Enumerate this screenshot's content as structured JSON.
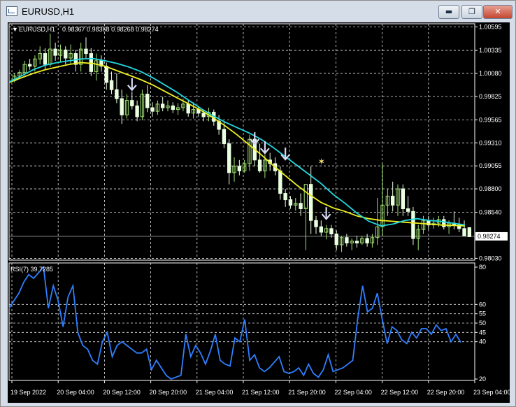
{
  "window": {
    "title": "EURUSD,H1",
    "minimize_label": "▬",
    "maximize_label": "❐",
    "close_label": "✕"
  },
  "chart_header": {
    "symbol": "EURUSD,H1",
    "ohlc": "0.98367 0.98368 0.98268 0.98274"
  },
  "price_axis": {
    "labels": [
      "1.00595",
      "1.00335",
      "1.00080",
      "0.99825",
      "0.99565",
      "0.99310",
      "0.99055",
      "0.98800",
      "0.98540",
      "0.98274",
      "0.98030"
    ],
    "current_price": "0.98274"
  },
  "rsi_panel": {
    "label": "RSI(7) 39.7285",
    "levels": [
      "80",
      "60",
      "55",
      "50",
      "45",
      "40",
      "20"
    ]
  },
  "time_axis": {
    "labels": [
      "19 Sep 2022",
      "20 Sep 04:00",
      "20 Sep 12:00",
      "20 Sep 20:00",
      "21 Sep 04:00",
      "21 Sep 12:00",
      "21 Sep 20:00",
      "22 Sep 04:00",
      "22 Sep 12:00",
      "22 Sep 20:00",
      "23 Sep 04:00"
    ]
  },
  "colors": {
    "background": "#000000",
    "grid": "#ffffff",
    "bull": "#a0e070",
    "bear": "#e8ffe0",
    "ma_fast": "#22d8e0",
    "ma_slow": "#f0f020",
    "rsi": "#2f7fff",
    "signal": "#d8d8f0",
    "star": "#f0e070"
  },
  "chart_data": {
    "type": "candlestick",
    "ylim": [
      0.9801,
      1.0063
    ],
    "rsi_ylim": [
      20,
      80
    ],
    "candles": [
      [
        1.0,
        1.0008,
        0.9998,
        1.0005
      ],
      [
        1.0005,
        1.0012,
        1.0002,
        1.0009
      ],
      [
        1.0009,
        1.0022,
        1.0006,
        1.0018
      ],
      [
        1.0018,
        1.0024,
        1.0012,
        1.0016
      ],
      [
        1.0016,
        1.0028,
        1.001,
        1.0024
      ],
      [
        1.0024,
        1.0038,
        1.0018,
        1.003
      ],
      [
        1.003,
        1.0036,
        1.0012,
        1.0018
      ],
      [
        1.0018,
        1.0052,
        1.0015,
        1.0035
      ],
      [
        1.0035,
        1.0042,
        1.0022,
        1.0028
      ],
      [
        1.0028,
        1.004,
        1.002,
        1.0034
      ],
      [
        1.0034,
        1.0038,
        1.0018,
        1.0025
      ],
      [
        1.0025,
        1.004,
        1.0018,
        1.003
      ],
      [
        1.003,
        1.0034,
        1.001,
        1.0018
      ],
      [
        1.0018,
        1.0042,
        1.001,
        1.0035
      ],
      [
        1.0035,
        1.0048,
        1.0025,
        1.003
      ],
      [
        1.003,
        1.0036,
        1.0005,
        1.001
      ],
      [
        1.001,
        1.003,
        1.0,
        1.0022
      ],
      [
        1.0022,
        1.0028,
        1.001,
        1.0016
      ],
      [
        1.0016,
        1.002,
        0.999,
        0.9998
      ],
      [
        1.0,
        1.001,
        0.9985,
        0.999
      ],
      [
        0.999,
        1.0008,
        0.9975,
        0.998
      ],
      [
        0.998,
        0.999,
        0.9952,
        0.9962
      ],
      [
        0.9962,
        0.9985,
        0.9958,
        0.9978
      ],
      [
        0.9978,
        0.9988,
        0.9968,
        0.9972
      ],
      [
        0.9972,
        0.9978,
        0.9955,
        0.996
      ],
      [
        0.996,
        0.999,
        0.9956,
        0.9985
      ],
      [
        0.9985,
        0.9995,
        0.9965,
        0.997
      ],
      [
        0.997,
        0.9976,
        0.996,
        0.9966
      ],
      [
        0.9966,
        0.9978,
        0.9962,
        0.9974
      ],
      [
        0.9974,
        0.9982,
        0.9966,
        0.997
      ],
      [
        0.997,
        0.9978,
        0.9966,
        0.9972
      ],
      [
        0.9972,
        0.9976,
        0.9964,
        0.9968
      ],
      [
        0.9968,
        0.9975,
        0.9962,
        0.997
      ],
      [
        0.997,
        0.998,
        0.9966,
        0.9974
      ],
      [
        0.9974,
        0.9978,
        0.996,
        0.9964
      ],
      [
        0.9964,
        0.9976,
        0.9958,
        0.9968
      ],
      [
        0.9968,
        0.9972,
        0.996,
        0.9964
      ],
      [
        0.9964,
        0.9968,
        0.9955,
        0.996
      ],
      [
        0.996,
        0.997,
        0.9955,
        0.9965
      ],
      [
        0.9965,
        0.9968,
        0.995,
        0.9955
      ],
      [
        0.9955,
        0.9962,
        0.994,
        0.9946
      ],
      [
        0.9946,
        0.9955,
        0.9925,
        0.993
      ],
      [
        0.993,
        0.9935,
        0.9885,
        0.9898
      ],
      [
        0.9898,
        0.9915,
        0.9888,
        0.9905
      ],
      [
        0.9905,
        0.9912,
        0.9895,
        0.99
      ],
      [
        0.99,
        0.9912,
        0.9898,
        0.9908
      ],
      [
        0.9908,
        0.994,
        0.99,
        0.9935
      ],
      [
        0.9935,
        0.994,
        0.9905,
        0.9912
      ],
      [
        0.9912,
        0.993,
        0.9898,
        0.99
      ],
      [
        0.99,
        0.9918,
        0.9892,
        0.9912
      ],
      [
        0.9912,
        0.992,
        0.99,
        0.9908
      ],
      [
        0.9908,
        0.9915,
        0.9895,
        0.99
      ],
      [
        0.99,
        0.9905,
        0.9868,
        0.9875
      ],
      [
        0.9875,
        0.988,
        0.986,
        0.9868
      ],
      [
        0.9868,
        0.9872,
        0.9858,
        0.9862
      ],
      [
        0.9862,
        0.987,
        0.9856,
        0.9864
      ],
      [
        0.9864,
        0.9875,
        0.985,
        0.9858
      ],
      [
        0.9858,
        0.986,
        0.9812,
        0.9885
      ],
      [
        0.9885,
        0.9905,
        0.983,
        0.9845
      ],
      [
        0.9845,
        0.985,
        0.983,
        0.9838
      ],
      [
        0.9838,
        0.9845,
        0.9828,
        0.9832
      ],
      [
        0.9832,
        0.984,
        0.9824,
        0.9836
      ],
      [
        0.9836,
        0.984,
        0.9826,
        0.983
      ],
      [
        0.983,
        0.9834,
        0.9812,
        0.9818
      ],
      [
        0.9818,
        0.9828,
        0.981,
        0.9826
      ],
      [
        0.9826,
        0.983,
        0.9816,
        0.982
      ],
      [
        0.982,
        0.9825,
        0.9812,
        0.9822
      ],
      [
        0.9822,
        0.9828,
        0.9815,
        0.982
      ],
      [
        0.982,
        0.9828,
        0.9818,
        0.9825
      ],
      [
        0.9825,
        0.983,
        0.9816,
        0.982
      ],
      [
        0.982,
        0.983,
        0.9815,
        0.9826
      ],
      [
        0.9826,
        0.987,
        0.9818,
        0.9838
      ],
      [
        0.9838,
        0.9908,
        0.9828,
        0.9862
      ],
      [
        0.9862,
        0.988,
        0.985,
        0.9872
      ],
      [
        0.9872,
        0.9888,
        0.9855,
        0.9862
      ],
      [
        0.9862,
        0.9885,
        0.985,
        0.988
      ],
      [
        0.988,
        0.9885,
        0.985,
        0.9858
      ],
      [
        0.9858,
        0.9872,
        0.985,
        0.9855
      ],
      [
        0.9855,
        0.986,
        0.9818,
        0.9825
      ],
      [
        0.9825,
        0.984,
        0.9812,
        0.9835
      ],
      [
        0.9835,
        0.985,
        0.983,
        0.9845
      ],
      [
        0.9845,
        0.985,
        0.9835,
        0.984
      ],
      [
        0.984,
        0.9848,
        0.9836,
        0.9842
      ],
      [
        0.9842,
        0.985,
        0.9838,
        0.9846
      ],
      [
        0.9846,
        0.985,
        0.9835,
        0.9838
      ],
      [
        0.9838,
        0.9845,
        0.983,
        0.9842
      ],
      [
        0.9842,
        0.9855,
        0.9835,
        0.984
      ],
      [
        0.984,
        0.9848,
        0.9832,
        0.9836
      ],
      [
        0.9836,
        0.9845,
        0.983,
        0.9828
      ],
      [
        0.9837,
        0.9837,
        0.9827,
        0.9827
      ]
    ],
    "ma_fast": [
      0.99985,
      1.0005,
      1.0012,
      1.0017,
      1.002,
      1.0022,
      1.0024,
      1.00245,
      1.0022,
      1.0019,
      1.0015,
      1.001,
      1.0003,
      0.9995,
      0.9987,
      0.9978,
      0.9969,
      0.9961,
      0.9954,
      0.9948,
      0.9942,
      0.9935,
      0.9926,
      0.9916,
      0.9906,
      0.9896,
      0.9886,
      0.9874,
      0.9864,
      0.9853,
      0.9844,
      0.9839,
      0.9841,
      0.9845,
      0.9847,
      0.9845,
      0.9844,
      0.9842,
      0.984
    ],
    "ma_slow": [
      0.9998,
      1.0003,
      1.0008,
      1.0012,
      1.0015,
      1.0018,
      1.002,
      1.0019,
      1.0016,
      1.0011,
      1.0006,
      1.0001,
      0.9995,
      0.9988,
      0.9981,
      0.9974,
      0.9967,
      0.9959,
      0.995,
      0.994,
      0.9929,
      0.9918,
      0.9906,
      0.9895,
      0.9884,
      0.9874,
      0.9865,
      0.9859,
      0.9855,
      0.985,
      0.9847,
      0.9845,
      0.9844,
      0.9843,
      0.9842,
      0.9841,
      0.984,
      0.98395,
      0.9839
    ],
    "rsi": [
      58,
      62,
      66,
      72,
      76,
      74,
      77,
      80,
      58,
      70,
      62,
      48,
      64,
      70,
      45,
      38,
      36,
      30,
      28,
      40,
      45,
      32,
      38,
      40,
      38,
      36,
      34,
      34,
      36,
      25,
      30,
      26,
      22,
      20,
      21,
      22,
      44,
      32,
      38,
      34,
      28,
      35,
      44,
      30,
      28,
      27,
      42,
      40,
      52,
      30,
      33,
      26,
      24,
      26,
      29,
      32,
      24,
      23,
      24,
      26,
      22,
      28,
      23,
      21,
      25,
      33,
      24,
      25,
      26,
      28,
      30,
      52,
      70,
      56,
      58,
      66,
      52,
      39,
      48,
      46,
      41,
      39,
      45,
      42,
      47,
      47,
      44,
      49,
      46,
      47,
      40,
      44,
      39.7
    ],
    "signals": [
      {
        "type": "arrow-down",
        "index": 23,
        "price": 0.9995
      },
      {
        "type": "arrow-down",
        "index": 47,
        "price": 0.9935
      },
      {
        "type": "arrow-down",
        "index": 49,
        "price": 0.9925
      },
      {
        "type": "arrow-down",
        "index": 53,
        "price": 0.9918
      },
      {
        "type": "star",
        "index": 60,
        "price": 0.991
      },
      {
        "type": "arrow-down",
        "index": 61,
        "price": 0.9852
      }
    ]
  }
}
